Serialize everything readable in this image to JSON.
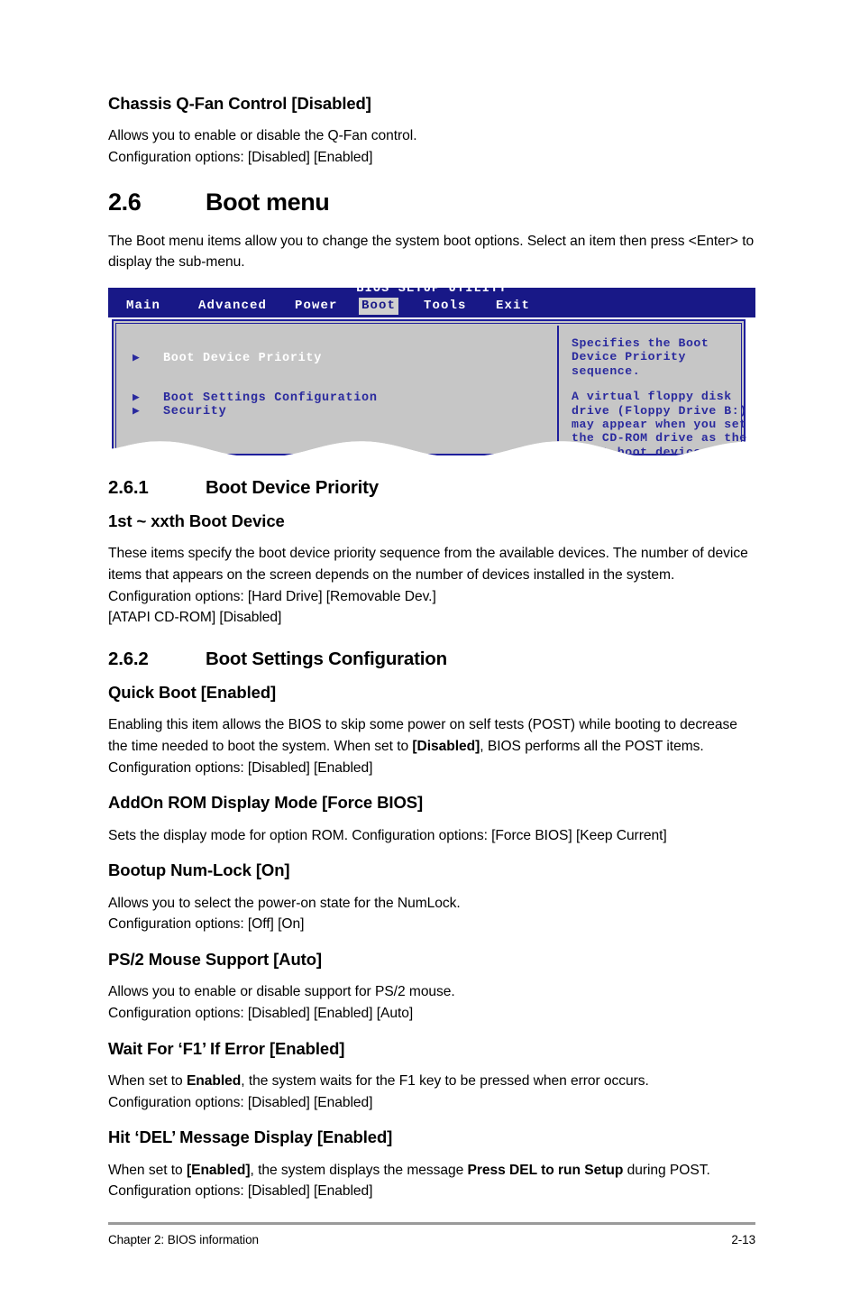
{
  "document": {
    "sections": [
      {
        "id": "chassis-qfan",
        "heading": "Chassis Q-Fan Control [Disabled]",
        "paragraph": "Allows you to enable or disable the Q-Fan control.\nConfiguration options: [Disabled] [Enabled]"
      }
    ]
  },
  "section_boot_menu": {
    "number": "2.6",
    "title": "Boot menu",
    "intro": "The Boot menu items allow you to change the system boot options. Select an item then press <Enter> to display the sub-menu."
  },
  "bios_screen": {
    "title": "BIOS SETUP UTILITY",
    "menu": [
      {
        "label": "Main",
        "selected": false
      },
      {
        "label": "Advanced",
        "selected": false
      },
      {
        "label": "Power",
        "selected": false
      },
      {
        "label": "Boot",
        "selected": true
      },
      {
        "label": "Tools",
        "selected": false
      },
      {
        "label": "Exit",
        "selected": false
      }
    ],
    "items": [
      {
        "label": "Boot Device Priority",
        "highlighted": true
      },
      {
        "label": "Boot Settings Configuration",
        "highlighted": false
      },
      {
        "label": "Security",
        "highlighted": false
      }
    ],
    "arrow_glyph": "▶",
    "help_paragraph_1": "Specifies the Boot\nDevice Priority\nsequence.",
    "help_paragraph_2": "A virtual floppy disk\ndrive (Floppy Drive B:)\nmay appear when you set\nthe CD-ROM drive as the\nfirst boot device.",
    "colors": {
      "header_blue": "#181887",
      "panel_gray": "#c6c6c6",
      "text_blue": "#2a2a9e",
      "highlight_white": "#ffffff",
      "tab_selected_bg": "#cfcfcf"
    }
  },
  "section_261": {
    "number": "2.6.1",
    "title": "Boot Device Priority",
    "subheading": "1st ~ xxth Boot Device",
    "paragraph": "These items specify the boot device priority sequence from the available devices. The number of device items that appears on the screen depends on the number of devices installed in the system. Configuration options: [Hard Drive] [Removable Dev.]\n[ATAPI CD-ROM] [Disabled]"
  },
  "section_262": {
    "number": "2.6.2",
    "title": "Boot Settings Configuration",
    "entries": [
      {
        "heading": "Quick Boot [Enabled]",
        "body_parts": [
          {
            "text": "Enabling this item allows the BIOS to skip some power on self tests (POST) while booting to decrease the time needed to boot the system. When set to ",
            "bold": false
          },
          {
            "text": "[Disabled]",
            "bold": true
          },
          {
            "text": ", BIOS performs all the POST items. Configuration options: [Disabled] [Enabled]",
            "bold": false
          }
        ]
      },
      {
        "heading": "AddOn ROM Display Mode [Force BIOS]",
        "body_parts": [
          {
            "text": "Sets the display mode for option ROM. Configuration options: [Force BIOS] [Keep Current]",
            "bold": false
          }
        ]
      },
      {
        "heading": "Bootup Num-Lock [On]",
        "body_parts": [
          {
            "text": "Allows you to select the power-on state for the NumLock.\nConfiguration options: [Off] [On]",
            "bold": false
          }
        ]
      },
      {
        "heading": "PS/2 Mouse Support [Auto]",
        "body_parts": [
          {
            "text": "Allows you to enable or disable support for PS/2 mouse.\nConfiguration options: [Disabled] [Enabled] [Auto]",
            "bold": false
          }
        ]
      },
      {
        "heading": "Wait For ‘F1’ If Error [Enabled]",
        "body_parts": [
          {
            "text": "When set to ",
            "bold": false
          },
          {
            "text": "Enabled",
            "bold": true
          },
          {
            "text": ", the system waits for the F1 key to be pressed when error occurs.\nConfiguration options: [Disabled] [Enabled]",
            "bold": false
          }
        ]
      },
      {
        "heading": "Hit ‘DEL’ Message Display [Enabled]",
        "body_parts": [
          {
            "text": "When set to ",
            "bold": false
          },
          {
            "text": "[Enabled]",
            "bold": true
          },
          {
            "text": ", the system displays the message ",
            "bold": false
          },
          {
            "text": "Press DEL to run Setup",
            "bold": true
          },
          {
            "text": " during POST. Configuration options: [Disabled] [Enabled]",
            "bold": false
          }
        ]
      }
    ]
  },
  "footer": {
    "chapter": "Chapter 2: BIOS information",
    "page_number": "2-13"
  }
}
